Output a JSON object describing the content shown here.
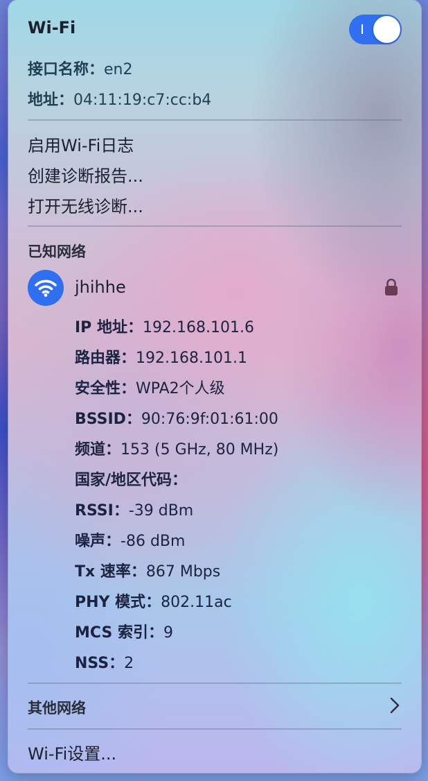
{
  "header": {
    "title": "Wi-Fi",
    "toggle_on": true
  },
  "interface": {
    "name_label": "接口名称：",
    "name_value": "en2",
    "address_label": "地址：",
    "address_value": "04:11:19:c7:cc:b4"
  },
  "menu": {
    "enable_log": "启用Wi-Fi日志",
    "create_report": "创建诊断报告...",
    "open_diagnostics": "打开无线诊断..."
  },
  "known_networks": {
    "heading": "已知网络",
    "network": {
      "name": "jhihhe",
      "icon": "wifi-icon",
      "secured_icon": "lock-icon",
      "details": [
        {
          "label": "IP 地址：",
          "value": "192.168.101.6"
        },
        {
          "label": "路由器：",
          "value": "192.168.101.1"
        },
        {
          "label": "安全性：",
          "value": "WPA2个人级"
        },
        {
          "label": "BSSID：",
          "value": "90:76:9f:01:61:00"
        },
        {
          "label": "频道：",
          "value": "153 (5 GHz, 80 MHz)"
        },
        {
          "label": "国家/地区代码：",
          "value": ""
        },
        {
          "label": "RSSI：",
          "value": "-39 dBm"
        },
        {
          "label": "噪声：",
          "value": "-86 dBm"
        },
        {
          "label": "Tx 速率：",
          "value": "867 Mbps"
        },
        {
          "label": "PHY 模式：",
          "value": "802.11ac"
        },
        {
          "label": "MCS 索引：",
          "value": "9"
        },
        {
          "label": "NSS：",
          "value": "2"
        }
      ]
    }
  },
  "other_networks": {
    "label": "其他网络",
    "icon": "chevron-right-icon"
  },
  "settings": {
    "label": "Wi-Fi设置..."
  },
  "colors": {
    "accent": "#2f6ff0",
    "lock": "#6b3a55"
  }
}
